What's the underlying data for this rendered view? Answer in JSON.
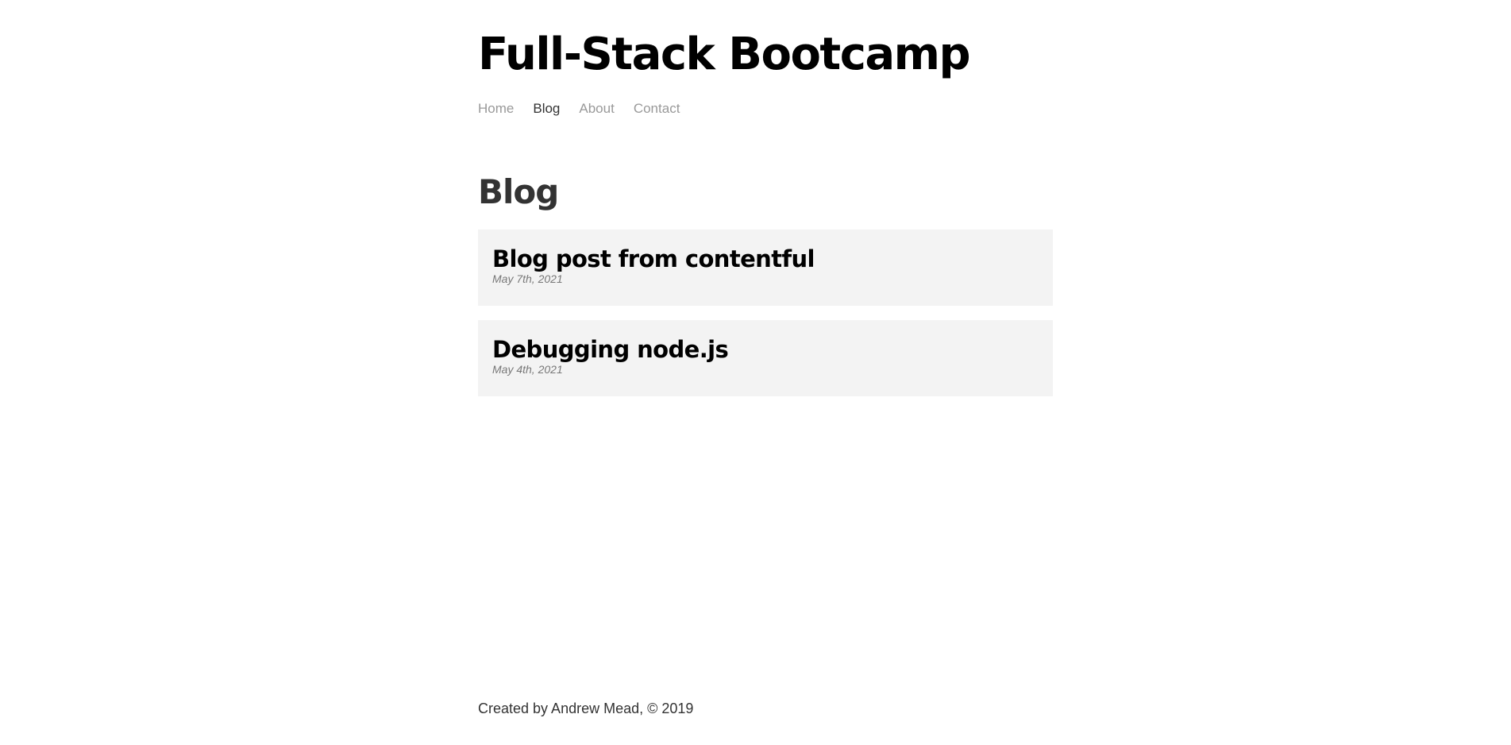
{
  "header": {
    "site_title": "Full-Stack Bootcamp",
    "nav": [
      {
        "label": "Home",
        "active": false
      },
      {
        "label": "Blog",
        "active": true
      },
      {
        "label": "About",
        "active": false
      },
      {
        "label": "Contact",
        "active": false
      }
    ]
  },
  "main": {
    "heading": "Blog",
    "posts": [
      {
        "title": "Blog post from contentful",
        "date": "May 7th, 2021"
      },
      {
        "title": "Debugging node.js",
        "date": "May 4th, 2021"
      }
    ]
  },
  "footer": {
    "text": "Created by Andrew Mead, © 2019"
  },
  "colors": {
    "text_primary": "#000000",
    "text_body": "#333333",
    "nav_inactive": "#999999",
    "post_background": "#f3f3f3",
    "post_date": "#777777"
  }
}
